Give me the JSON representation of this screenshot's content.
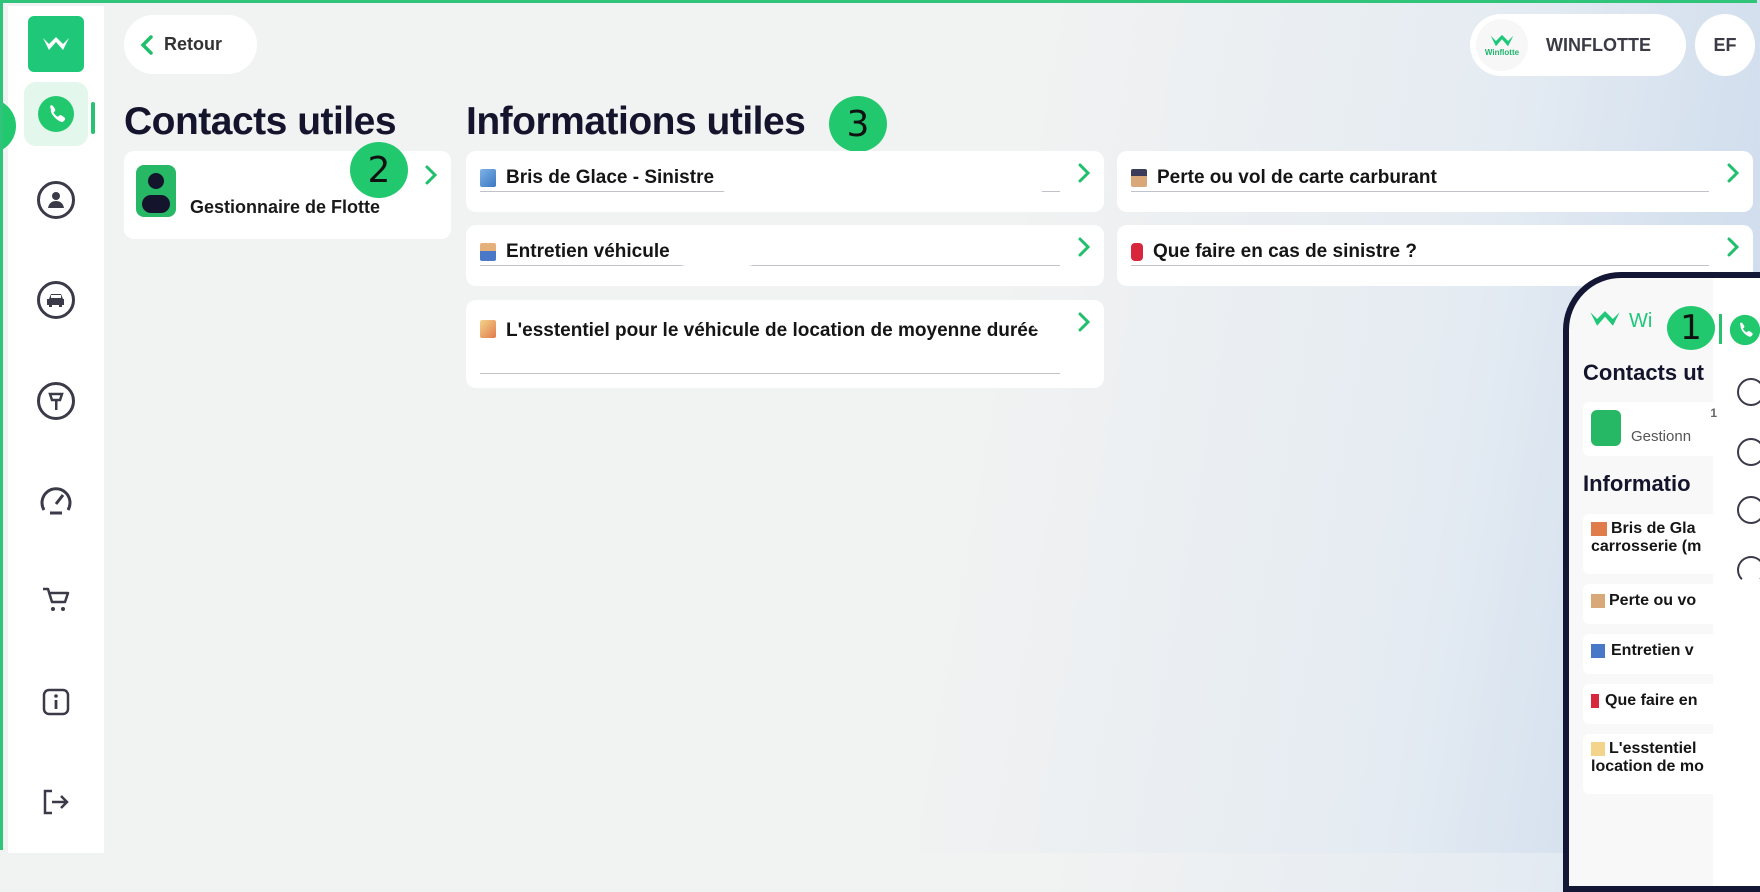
{
  "header": {
    "back_label": "Retour",
    "org_logo_text": "Winflotte",
    "org_name": "WINFLOTTE",
    "user_initials": "EF"
  },
  "sidebar": {
    "items": [
      {
        "name": "phone-icon",
        "active": true
      },
      {
        "name": "user-icon"
      },
      {
        "name": "car-icon"
      },
      {
        "name": "fuel-pump-icon"
      },
      {
        "name": "speedometer-icon"
      },
      {
        "name": "cart-icon"
      },
      {
        "name": "info-icon"
      },
      {
        "name": "logout-icon"
      }
    ]
  },
  "contacts": {
    "title": "Contacts utiles",
    "items": [
      {
        "label": "Gestionnaire de Flotte"
      }
    ]
  },
  "informations": {
    "title": "Informations utiles",
    "items": [
      {
        "icon": "window-icon",
        "label": "Bris de Glace - Sinistre"
      },
      {
        "icon": "police-officer-icon",
        "label": "Perte ou vol de carte carburant"
      },
      {
        "icon": "mechanic-icon",
        "label": "Entretien véhicule"
      },
      {
        "icon": "fire-extinguisher-icon",
        "label": "Que faire en cas de sinistre ?"
      },
      {
        "icon": "memo-icon",
        "label": "L'esstentiel pour le véhicule de location de moyenne durée"
      }
    ]
  },
  "badges": {
    "b1": "1",
    "b2": "2",
    "b3": "3"
  },
  "phone_preview": {
    "logo_text": "Wi",
    "contacts_title": "Contacts ut",
    "contact_label": "Gestionn",
    "contact_num": "1",
    "info_title": "Informatio",
    "items": [
      "Bris de Gla",
      "carrosserie (m",
      "Perte ou vo",
      "Entretien v",
      "Que faire en",
      "L'esstentiel",
      "location de mo"
    ]
  },
  "colors": {
    "accent": "#22c86d",
    "title": "#14152c",
    "frame": "#2fc47a"
  }
}
